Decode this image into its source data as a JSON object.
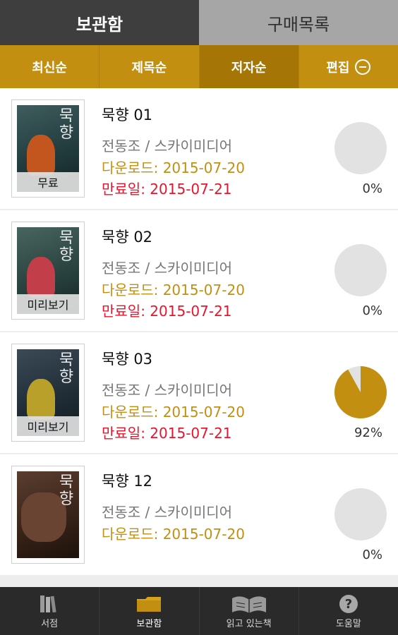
{
  "tabs": [
    {
      "label": "보관함",
      "active": true
    },
    {
      "label": "구매목록",
      "active": false
    }
  ],
  "sort": {
    "items": [
      "최신순",
      "제목순",
      "저자순"
    ],
    "selected_index": 2,
    "edit_label": "편집",
    "edit_icon": "minus-circle-icon"
  },
  "books": [
    {
      "title": "묵향 01",
      "author": "전동조 / 스카이미디어",
      "download": "다운로드: 2015-07-20",
      "expire": "만료일: 2015-07-21",
      "badge": "무료",
      "cover_text": "묵향",
      "progress_percent": 0,
      "progress_label": "0%"
    },
    {
      "title": "묵향 02",
      "author": "전동조 / 스카이미디어",
      "download": "다운로드: 2015-07-20",
      "expire": "만료일: 2015-07-21",
      "badge": "미리보기",
      "cover_text": "묵향",
      "progress_percent": 0,
      "progress_label": "0%"
    },
    {
      "title": "묵향 03",
      "author": "전동조 / 스카이미디어",
      "download": "다운로드: 2015-07-20",
      "expire": "만료일: 2015-07-21",
      "badge": "미리보기",
      "cover_text": "묵향",
      "progress_percent": 92,
      "progress_label": "92%"
    },
    {
      "title": "묵향 12",
      "author": "전동조 / 스카이미디어",
      "download": "다운로드: 2015-07-20",
      "cover_text": "묵향",
      "progress_percent": 0,
      "progress_label": "0%"
    }
  ],
  "nav": [
    {
      "label": "서점",
      "icon": "books-icon",
      "active": false
    },
    {
      "label": "보관함",
      "icon": "folder-icon",
      "active": true
    },
    {
      "label": "읽고 있는책",
      "icon": "open-book-icon",
      "active": false
    },
    {
      "label": "도움말",
      "icon": "help-icon",
      "active": false
    }
  ],
  "colors": {
    "accent": "#c28f10",
    "expire": "#e8142c",
    "progress_empty": "#e2e2e2",
    "progress_fill": "#c28f10"
  }
}
